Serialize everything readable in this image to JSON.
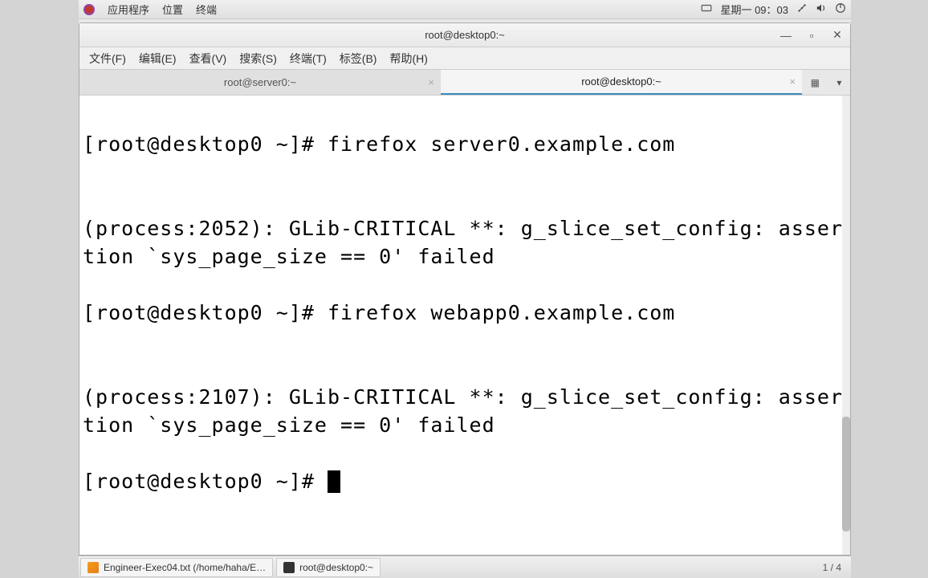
{
  "top_panel": {
    "menu": [
      "应用程序",
      "位置",
      "终端"
    ],
    "clock": "星期一 09：03"
  },
  "window": {
    "title": "root@desktop0:~"
  },
  "menubar": {
    "items": [
      "文件(F)",
      "编辑(E)",
      "查看(V)",
      "搜索(S)",
      "终端(T)",
      "标签(B)",
      "帮助(H)"
    ]
  },
  "tabs": [
    {
      "label": "root@server0:~",
      "active": false
    },
    {
      "label": "root@desktop0:~",
      "active": true
    }
  ],
  "tab_bar": {
    "new_tab_glyph": "▦",
    "dropdown_glyph": "▾"
  },
  "terminal": {
    "lines": [
      "[root@desktop0 ~]# firefox server0.example.com",
      "",
      "(process:2052): GLib-CRITICAL **: g_slice_set_config: assertion `sys_page_size == 0' failed",
      "[root@desktop0 ~]# firefox webapp0.example.com",
      "",
      "(process:2107): GLib-CRITICAL **: g_slice_set_config: assertion `sys_page_size == 0' failed"
    ],
    "prompt": "[root@desktop0 ~]# "
  },
  "taskbar": {
    "items": [
      {
        "label": "Engineer-Exec04.txt (/home/haha/E…",
        "icon": "editor"
      },
      {
        "label": "root@desktop0:~",
        "icon": "term"
      }
    ],
    "workspace": "1 / 4"
  }
}
